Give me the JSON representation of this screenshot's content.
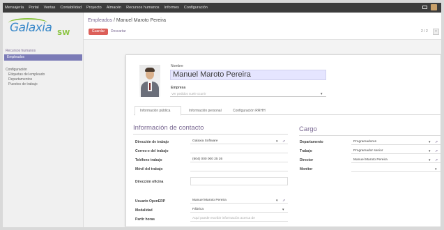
{
  "topbar": {
    "menu": [
      "Mensajería",
      "Portal",
      "Ventas",
      "Contabilidad",
      "Proyecto",
      "Almacén",
      "Recursos humanos",
      "Informes",
      "Configuración"
    ]
  },
  "sidebar": {
    "logo_word": "Galaxia",
    "logo_suffix": "SW",
    "section_title": "Recursos humanos",
    "active_item": "Empleados",
    "config_title": "Configuración",
    "config_items": [
      "Etiquetas del empleado",
      "Departamentos",
      "Puestos de trabajo"
    ]
  },
  "breadcrumb": {
    "parent": "Empleados",
    "separator": " / ",
    "current": "Manuel Maroto Pereira"
  },
  "actions": {
    "save": "Guardar",
    "discard": "Descartar",
    "pager": "2 / 2",
    "next": "›"
  },
  "header": {
    "name_label": "Nombre",
    "name_value": "Manuel Maroto Pereira",
    "company_label": "Empresa",
    "company_placeholder": "Ver pedidos suele ocurrir"
  },
  "tabs": [
    "Información pública",
    "Información personal",
    "Configuración RRHH"
  ],
  "contact": {
    "title": "Información de contacto",
    "fields": [
      {
        "label": "Dirección de trabajo",
        "value": "Galaxia Software"
      },
      {
        "label": "Correo-e del trabajo",
        "value": ""
      },
      {
        "label": "Teléfono trabajo",
        "value": "(604) 000 000 25 26"
      },
      {
        "label": "Móvil del trabajo",
        "value": ""
      },
      {
        "label": "Dirección oficina",
        "value": ""
      }
    ],
    "extra_fields": [
      {
        "label": "Usuario OpenERP",
        "value": "Manuel Maroto Pereira"
      },
      {
        "label": "Modalidad",
        "value": "Fábrica"
      },
      {
        "label": "Partir horas",
        "value": "Aquí puede escribir información acerca de"
      }
    ]
  },
  "cargo": {
    "title": "Cargo",
    "fields": [
      {
        "label": "Departamento",
        "value": "Programadores"
      },
      {
        "label": "Trabajo",
        "value": "Programador senior"
      },
      {
        "label": "Director",
        "value": "Manuel Maroto Pereira"
      },
      {
        "label": "Monitor",
        "value": ""
      }
    ]
  },
  "icons": {
    "external_link": "⇗",
    "caret": "▾"
  }
}
